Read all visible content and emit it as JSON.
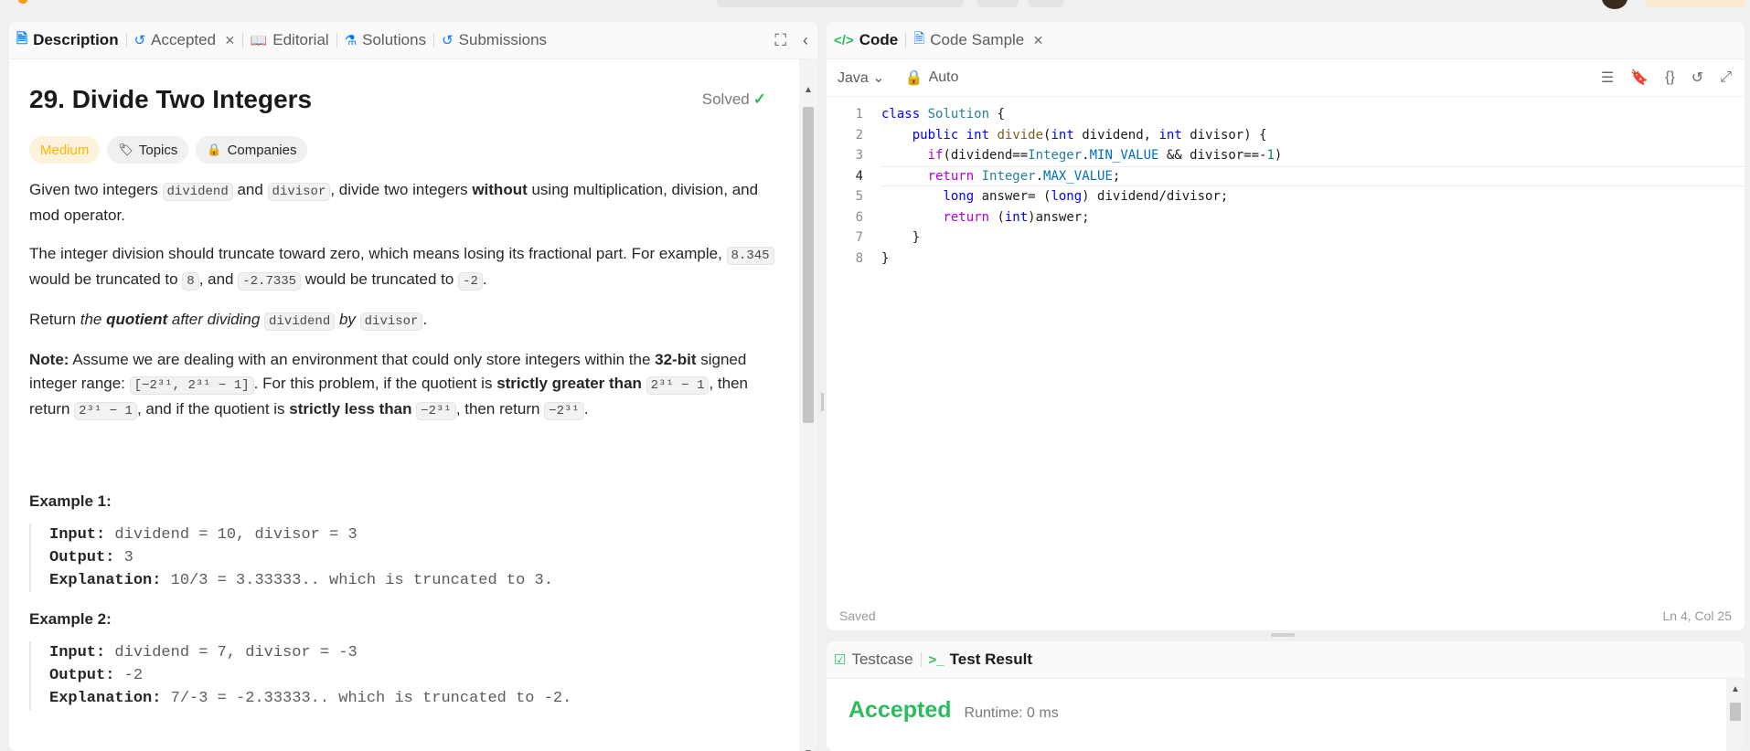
{
  "left_tabs": [
    {
      "label": "Description",
      "icon": "description-icon"
    },
    {
      "label": "Accepted",
      "icon": "history-icon"
    },
    {
      "label": "Editorial",
      "icon": "book-icon"
    },
    {
      "label": "Solutions",
      "icon": "flask-icon"
    },
    {
      "label": "Submissions",
      "icon": "history-icon"
    }
  ],
  "problem": {
    "title": "29. Divide Two Integers",
    "solved_label": "Solved",
    "difficulty": "Medium",
    "topics_label": "Topics",
    "companies_label": "Companies",
    "p1": {
      "a": "Given two integers ",
      "c1": "dividend",
      "b": " and ",
      "c2": "divisor",
      "c": ", divide two integers ",
      "strong": "without",
      "d": " using multiplication, division, and mod operator."
    },
    "p2": {
      "a": "The integer division should truncate toward zero, which means losing its fractional part. For example, ",
      "c1": "8.345",
      "b": " would be truncated to ",
      "c2": "8",
      "c": ", and ",
      "c3": "-2.7335",
      "d": " would be truncated to ",
      "c4": "-2",
      "e": "."
    },
    "p3": {
      "a": "Return ",
      "em1": "the ",
      "strongem": "quotient",
      "em2": " after dividing",
      "c1": "dividend",
      "em3": " by ",
      "c2": "divisor",
      "e": "."
    },
    "p4": {
      "note": "Note:",
      "a": " Assume we are dealing with an environment that could only store integers within the ",
      "bits": "32-bit",
      "b": " signed integer range: ",
      "range": "[−2³¹, 2³¹ − 1]",
      "c": ". For this problem, if the quotient is ",
      "sg": "strictly greater than",
      "c1": "2³¹ − 1",
      "d": ", then return ",
      "c2": "2³¹ − 1",
      "e": ", and if the quotient is ",
      "sl": "strictly less than",
      "c3": "−2³¹",
      "f": ", then return ",
      "c4": "−2³¹",
      "g": "."
    },
    "examples": [
      {
        "title": "Example 1:",
        "input_label": "Input:",
        "input": "dividend = 10, divisor = 3",
        "output_label": "Output:",
        "output": "3",
        "explanation_label": "Explanation:",
        "explanation": "10/3 = 3.33333.. which is truncated to 3."
      },
      {
        "title": "Example 2:",
        "input_label": "Input:",
        "input": "dividend = 7, divisor = -3",
        "output_label": "Output:",
        "output": "-2",
        "explanation_label": "Explanation:",
        "explanation": "7/-3 = -2.33333.. which is truncated to -2."
      }
    ]
  },
  "editor": {
    "tabs": [
      {
        "label": "Code",
        "icon": "code-icon"
      },
      {
        "label": "Code Sample",
        "icon": "file-icon"
      }
    ],
    "language": "Java",
    "mode": "Auto",
    "status_left": "Saved",
    "status_right": "Ln 4, Col 25",
    "line_numbers": [
      "1",
      "2",
      "3",
      "4",
      "5",
      "6",
      "7",
      "8"
    ]
  },
  "result": {
    "tabs": [
      {
        "label": "Testcase",
        "icon": "checkbox-icon"
      },
      {
        "label": "Test Result",
        "icon": "terminal-icon"
      }
    ],
    "status": "Accepted",
    "runtime": "Runtime: 0 ms"
  },
  "colors": {
    "accepted": "#2cbb5d",
    "medium": "#ffb700",
    "tab_accent": "#007bff"
  }
}
